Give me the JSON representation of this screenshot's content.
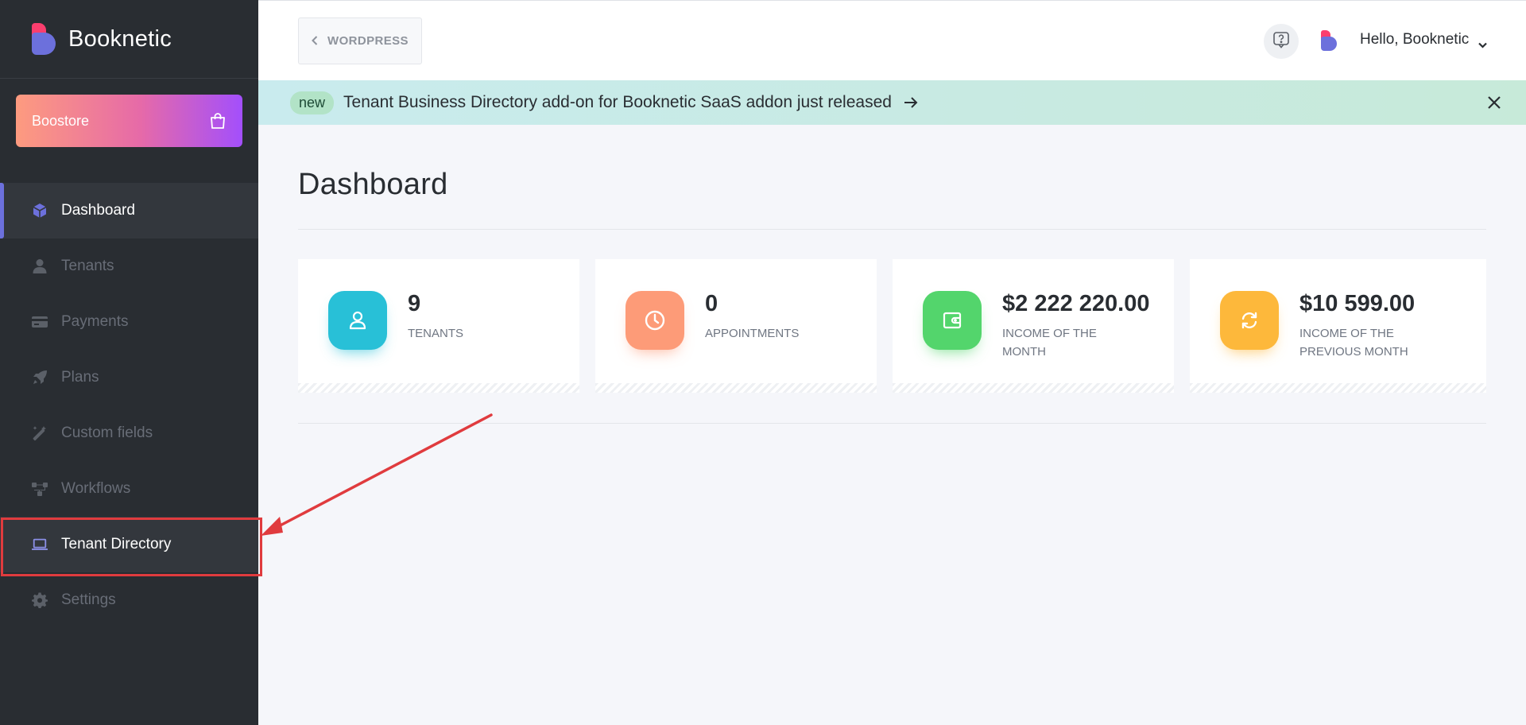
{
  "app": {
    "name": "Booknetic"
  },
  "sidebar": {
    "boostore_label": "Boostore",
    "items": [
      {
        "label": "Dashboard",
        "icon": "cube-icon"
      },
      {
        "label": "Tenants",
        "icon": "user-tie-icon"
      },
      {
        "label": "Payments",
        "icon": "credit-card-icon"
      },
      {
        "label": "Plans",
        "icon": "rocket-icon"
      },
      {
        "label": "Custom fields",
        "icon": "magic-wand-icon"
      },
      {
        "label": "Workflows",
        "icon": "workflow-icon"
      },
      {
        "label": "Tenant Directory",
        "icon": "laptop-icon"
      },
      {
        "label": "Settings",
        "icon": "gear-icon"
      }
    ],
    "active_item": "Dashboard",
    "highlighted_item": "Tenant Directory"
  },
  "topbar": {
    "back_label": "WORDPRESS",
    "greeting": "Hello, Booknetic"
  },
  "banner": {
    "badge": "new",
    "text": "Tenant Business Directory add-on for Booknetic SaaS addon just released"
  },
  "page": {
    "title": "Dashboard"
  },
  "stats": [
    {
      "value": "9",
      "label": "TENANTS",
      "color": "#28c0d7",
      "icon": "user-icon"
    },
    {
      "value": "0",
      "label": "APPOINTMENTS",
      "color": "#fd9b78",
      "icon": "clock-icon"
    },
    {
      "value": "$2 222 220.00",
      "label": "INCOME OF THE MONTH",
      "color": "#53d56c",
      "icon": "wallet-icon"
    },
    {
      "value": "$10 599.00",
      "label": "INCOME OF THE PREVIOUS MONTH",
      "color": "#fdb83b",
      "icon": "refresh-icon"
    }
  ],
  "colors": {
    "sidebar_bg": "#292d32",
    "accent": "#6c70dc",
    "brand_pink": "#fb3e6e",
    "annotation_red": "#e03b3e"
  }
}
